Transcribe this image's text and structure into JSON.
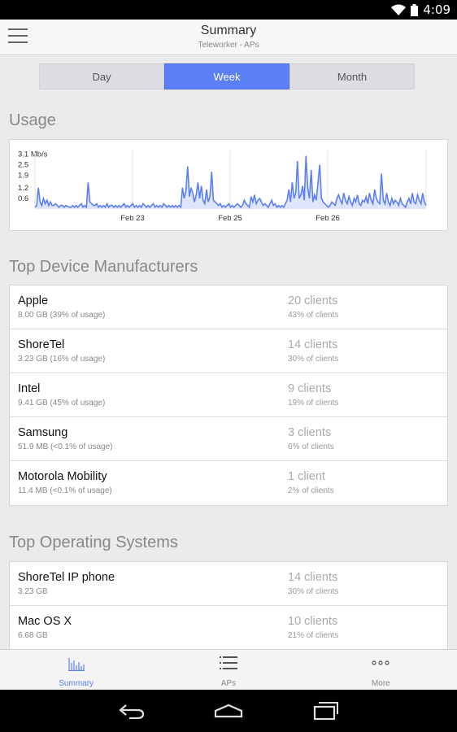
{
  "status_bar": {
    "time": "4:09"
  },
  "header": {
    "title": "Summary",
    "subtitle": "Teleworker - APs"
  },
  "segments": [
    {
      "label": "Day",
      "active": false
    },
    {
      "label": "Week",
      "active": true
    },
    {
      "label": "Month",
      "active": false
    }
  ],
  "usage": {
    "title": "Usage",
    "chart_data": {
      "type": "area",
      "ylabel": "",
      "y_ticks": [
        "3.1 Mb/s",
        "2.5",
        "1.9",
        "1.2",
        "0.6"
      ],
      "x_ticks": [
        "Feb 23",
        "Feb 25",
        "Feb 26"
      ],
      "grid": true,
      "color": "#5b7ff5",
      "series": [
        {
          "values": [
            0.1,
            0.2,
            1.2,
            0.4,
            0.2,
            0.6,
            0.3,
            0.5,
            0.2,
            0.4,
            0.2,
            0.2,
            0.3,
            0.2,
            0.1,
            0.2,
            0.2,
            0.1,
            0.2,
            0.15,
            0.1,
            0.1,
            0.2,
            0.1,
            0.2,
            0.1,
            0.2,
            0.3,
            0.1,
            0.2,
            0.1,
            1.5,
            0.4,
            0.3,
            0.2,
            0.2,
            0.3,
            0.1,
            0.2,
            0.1,
            0.2,
            0.1,
            0.3,
            0.1,
            0.2,
            0.2,
            0.1,
            0.2,
            0.1,
            0.2,
            0.1,
            0.2,
            0.3,
            0.1,
            0.2,
            0.1,
            0.2,
            0.3,
            0.1,
            0.2,
            0.1,
            0.2,
            0.1,
            0.3,
            0.2,
            0.1,
            0.2,
            0.1,
            0.2,
            0.3,
            0.1,
            0.2,
            0.1,
            0.2,
            0.1,
            0.3,
            0.2,
            0.1,
            0.2,
            0.1,
            0.2,
            0.1,
            0.2,
            0.1,
            0.2,
            0.1,
            1.2,
            0.6,
            1.0,
            2.4,
            0.7,
            1.2,
            0.9,
            0.4,
            0.8,
            1.5,
            0.6,
            1.3,
            0.5,
            0.3,
            1.1,
            0.4,
            0.7,
            2.1,
            0.5,
            0.4,
            0.3,
            0.2,
            0.3,
            0.1,
            0.2,
            0.1,
            0.2,
            0.3,
            0.1,
            0.2,
            0.1,
            0.2,
            0.3,
            0.2,
            0.1,
            0.2,
            0.5,
            0.3,
            0.2,
            0.1,
            0.7,
            0.4,
            0.8,
            0.3,
            0.5,
            0.6,
            0.4,
            0.2,
            0.3,
            0.2,
            0.1,
            0.3,
            0.5,
            0.2,
            0.3,
            0.1,
            0.2,
            0.1,
            0.2,
            0.1,
            0.3,
            0.5,
            1.1,
            0.4,
            1.5,
            0.6,
            0.9,
            2.7,
            0.6,
            0.8,
            1.3,
            0.5,
            3.0,
            1.2,
            0.6,
            2.2,
            0.4,
            0.8,
            0.5,
            1.5,
            2.5,
            0.6,
            0.4,
            0.3,
            0.2,
            0.1,
            0.2,
            0.4,
            0.3,
            0.2,
            0.6,
            0.8,
            0.5,
            0.3,
            0.9,
            0.5,
            0.3,
            0.7,
            0.4,
            0.2,
            0.6,
            0.4,
            0.8,
            0.3,
            0.2,
            0.5,
            0.4,
            0.7,
            0.3,
            0.9,
            0.5,
            0.3,
            1.1,
            0.6,
            0.4,
            0.3,
            2.0,
            0.5,
            0.3,
            0.9,
            0.4,
            0.2,
            0.6,
            0.3,
            0.5,
            0.4,
            0.2,
            0.6,
            0.3,
            0.2,
            0.1,
            0.4,
            0.6,
            0.3,
            0.9,
            0.4,
            0.3,
            0.8,
            0.5,
            0.3,
            0.9,
            0.4,
            0.2
          ]
        }
      ]
    }
  },
  "manufacturers": {
    "title": "Top Device Manufacturers",
    "rows": [
      {
        "name": "Apple",
        "usage": "8.00 GB (39% of usage)",
        "clients": "20 clients",
        "pct": "43% of clients"
      },
      {
        "name": "ShoreTel",
        "usage": "3.23 GB (16% of usage)",
        "clients": "14 clients",
        "pct": "30% of clients"
      },
      {
        "name": "Intel",
        "usage": "9.41 GB (45% of usage)",
        "clients": "9 clients",
        "pct": "19% of clients"
      },
      {
        "name": "Samsung",
        "usage": "51.9 MB (<0.1% of usage)",
        "clients": "3 clients",
        "pct": "6% of clients"
      },
      {
        "name": "Motorola Mobility",
        "usage": "11.4 MB (<0.1% of usage)",
        "clients": "1 client",
        "pct": "2% of clients"
      }
    ]
  },
  "operating_systems": {
    "title": "Top Operating Systems",
    "rows": [
      {
        "name": "ShoreTel IP phone",
        "usage": "3.23 GB",
        "clients": "14 clients",
        "pct": "30% of clients"
      },
      {
        "name": "Mac OS X",
        "usage": "6.68 GB",
        "clients": "10 clients",
        "pct": "21% of clients"
      }
    ]
  },
  "tabs": [
    {
      "label": "Summary",
      "icon": "bar-chart-icon",
      "active": true
    },
    {
      "label": "APs",
      "icon": "list-icon",
      "active": false
    },
    {
      "label": "More",
      "icon": "more-dots-icon",
      "active": false
    }
  ],
  "colors": {
    "accent": "#5b7ff5"
  }
}
